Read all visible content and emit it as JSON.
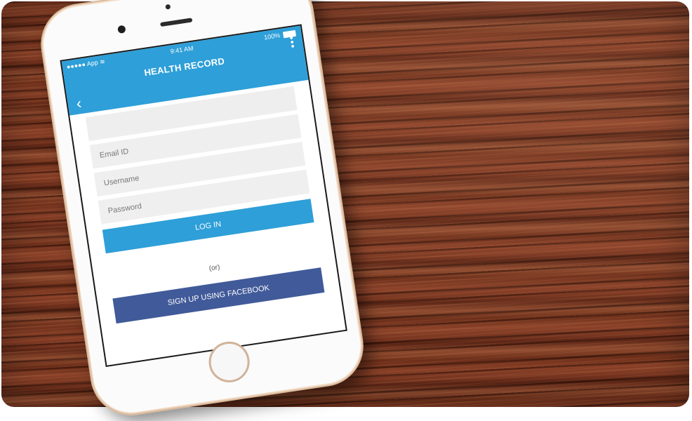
{
  "status_bar": {
    "carrier": "App",
    "time": "9:41 AM",
    "battery": "100%"
  },
  "header": {
    "title": "HEALTH RECORD",
    "back_icon": "chevron-left-icon",
    "menu_icon": "more-vertical-icon"
  },
  "form": {
    "blank_field_placeholder": "",
    "email_placeholder": "Email ID",
    "username_placeholder": "Username",
    "password_placeholder": "Password",
    "login_label": "LOG IN",
    "or_label": "(or)",
    "facebook_label": "SIGN UP USING FACEBOOK"
  },
  "colors": {
    "primary": "#2e9fd8",
    "facebook": "#415a99",
    "field_bg": "#efefef"
  }
}
